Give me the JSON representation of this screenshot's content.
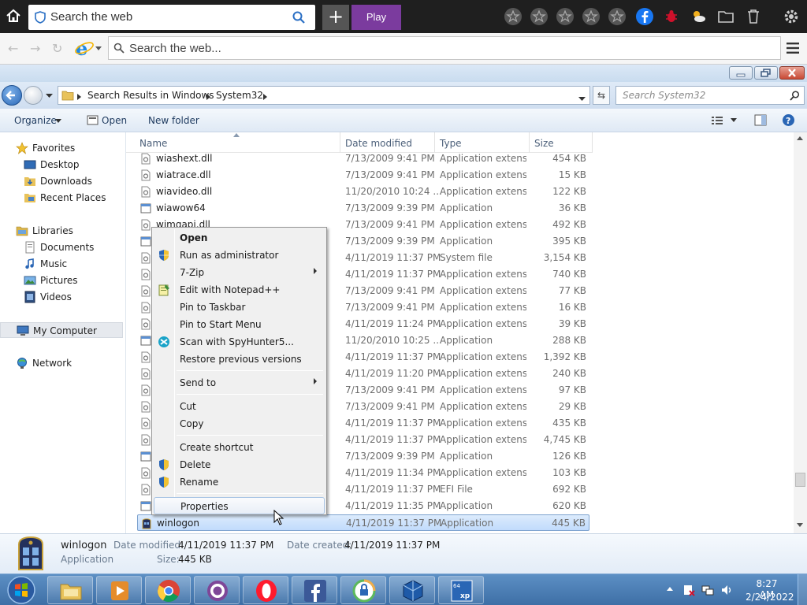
{
  "browser": {
    "top_search_placeholder": "Search the web",
    "play_label": "Play",
    "plus_label": "+",
    "address_placeholder": "Search the web..."
  },
  "explorer": {
    "breadcrumb": [
      "Search Results in Windows",
      "System32"
    ],
    "search_placeholder": "Search System32",
    "commands": {
      "organize": "Organize",
      "open": "Open",
      "new_folder": "New folder"
    },
    "nav": {
      "favorites": "Favorites",
      "desktop": "Desktop",
      "downloads": "Downloads",
      "recent_places": "Recent Places",
      "libraries": "Libraries",
      "documents": "Documents",
      "music": "Music",
      "pictures": "Pictures",
      "videos": "Videos",
      "my_computer": "My Computer",
      "network": "Network"
    },
    "columns": {
      "name": "Name",
      "date_modified": "Date modified",
      "type": "Type",
      "size": "Size"
    },
    "files": [
      {
        "name": "wiashext.dll",
        "date": "7/13/2009 9:41 PM",
        "type": "Application extens...",
        "size": "454 KB"
      },
      {
        "name": "wiatrace.dll",
        "date": "7/13/2009 9:41 PM",
        "type": "Application extens...",
        "size": "15 KB"
      },
      {
        "name": "wiavideo.dll",
        "date": "11/20/2010 10:24 ...",
        "type": "Application extens...",
        "size": "122 KB"
      },
      {
        "name": "wiawow64",
        "date": "7/13/2009 9:39 PM",
        "type": "Application",
        "size": "36 KB"
      },
      {
        "name": "wimgapi.dll",
        "date": "7/13/2009 9:41 PM",
        "type": "Application extens...",
        "size": "492 KB"
      },
      {
        "name": "",
        "date": "7/13/2009 9:39 PM",
        "type": "Application",
        "size": "395 KB"
      },
      {
        "name": "",
        "date": "4/11/2019 11:37 PM",
        "type": "System file",
        "size": "3,154 KB"
      },
      {
        "name": "",
        "date": "4/11/2019 11:37 PM",
        "type": "Application extens...",
        "size": "740 KB"
      },
      {
        "name": "",
        "date": "7/13/2009 9:41 PM",
        "type": "Application extens...",
        "size": "77 KB"
      },
      {
        "name": "",
        "date": "7/13/2009 9:41 PM",
        "type": "Application extens...",
        "size": "16 KB"
      },
      {
        "name": "",
        "date": "4/11/2019 11:24 PM",
        "type": "Application extens...",
        "size": "39 KB"
      },
      {
        "name": "",
        "date": "11/20/2010 10:25 ...",
        "type": "Application",
        "size": "288 KB"
      },
      {
        "name": "",
        "date": "4/11/2019 11:37 PM",
        "type": "Application extens...",
        "size": "1,392 KB"
      },
      {
        "name": "",
        "date": "4/11/2019 11:20 PM",
        "type": "Application extens...",
        "size": "240 KB"
      },
      {
        "name": "",
        "date": "7/13/2009 9:41 PM",
        "type": "Application extens...",
        "size": "97 KB"
      },
      {
        "name": "",
        "date": "7/13/2009 9:41 PM",
        "type": "Application extens...",
        "size": "29 KB"
      },
      {
        "name": "",
        "date": "4/11/2019 11:37 PM",
        "type": "Application extens...",
        "size": "435 KB"
      },
      {
        "name": "",
        "date": "4/11/2019 11:37 PM",
        "type": "Application extens...",
        "size": "4,745 KB"
      },
      {
        "name": "",
        "date": "7/13/2009 9:39 PM",
        "type": "Application",
        "size": "126 KB"
      },
      {
        "name": "",
        "date": "4/11/2019 11:34 PM",
        "type": "Application extens...",
        "size": "103 KB"
      },
      {
        "name": "",
        "date": "4/11/2019 11:37 PM",
        "type": "EFI File",
        "size": "692 KB"
      },
      {
        "name": "",
        "date": "4/11/2019 11:35 PM",
        "type": "Application",
        "size": "620 KB"
      },
      {
        "name": "winlogon",
        "date": "4/11/2019 11:37 PM",
        "type": "Application",
        "size": "445 KB"
      }
    ],
    "context_menu": {
      "open": "Open",
      "run_as_admin": "Run as administrator",
      "zip": "7-Zip",
      "edit_notepad": "Edit with Notepad++",
      "pin_taskbar": "Pin to Taskbar",
      "pin_start": "Pin to Start Menu",
      "scan_spyhunter": "Scan with SpyHunter5...",
      "restore_versions": "Restore previous versions",
      "send_to": "Send to",
      "cut": "Cut",
      "copy": "Copy",
      "create_shortcut": "Create shortcut",
      "delete": "Delete",
      "rename": "Rename",
      "properties": "Properties"
    },
    "details": {
      "name": "winlogon",
      "type": "Application",
      "date_modified_label": "Date modified:",
      "date_modified": "4/11/2019 11:37 PM",
      "date_created_label": "Date created:",
      "date_created": "4/11/2019 11:37 PM",
      "size_label": "Size:",
      "size": "445 KB"
    }
  },
  "taskbar": {
    "time": "8:27 AM",
    "date": "2/24/2022"
  },
  "colors": {
    "accent_play": "#7b3b9e",
    "selection": "#c1dbfc",
    "taskbar": "#4a7db5"
  }
}
